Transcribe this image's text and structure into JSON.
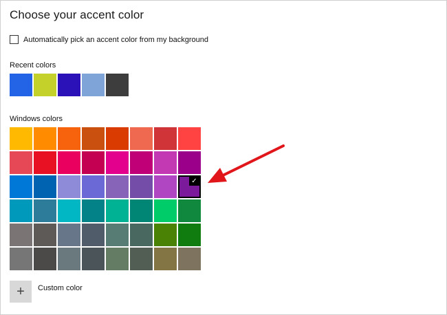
{
  "page": {
    "title": "Choose your accent color"
  },
  "auto_pick": {
    "label": "Automatically pick an accent color from my background",
    "checked": false
  },
  "recent_colors": {
    "label": "Recent colors",
    "swatches": [
      "#2363e6",
      "#c4d12b",
      "#2b12b8",
      "#7ea4d8",
      "#3d3d3d"
    ]
  },
  "windows_colors": {
    "label": "Windows colors",
    "selected": "#7c1a9c",
    "rows": [
      [
        "#ffb900",
        "#ff8c00",
        "#f7630c",
        "#ca5010",
        "#da3b01",
        "#ef6950",
        "#d13438",
        "#ff4343"
      ],
      [
        "#e74856",
        "#e81123",
        "#ea005e",
        "#c30052",
        "#e3008c",
        "#bf0077",
        "#c239b3",
        "#9a0089"
      ],
      [
        "#0078d7",
        "#0063b1",
        "#8e8cd8",
        "#6b69d6",
        "#8764b8",
        "#744da9",
        "#b146c2",
        "#7c1a9c"
      ],
      [
        "#0099bc",
        "#2d7d9a",
        "#00b7c3",
        "#038387",
        "#00b294",
        "#018574",
        "#00cc6a",
        "#10893e"
      ],
      [
        "#7a7574",
        "#5d5a58",
        "#68768a",
        "#515c6b",
        "#567c73",
        "#486860",
        "#498205",
        "#107c10"
      ],
      [
        "#767676",
        "#4c4a48",
        "#69797e",
        "#4a5459",
        "#647c64",
        "#525e54",
        "#847545",
        "#7e735f"
      ]
    ]
  },
  "custom_color": {
    "label": "Custom color",
    "icon": "plus-icon"
  },
  "annotation": {
    "arrow_color": "#e0161b"
  }
}
